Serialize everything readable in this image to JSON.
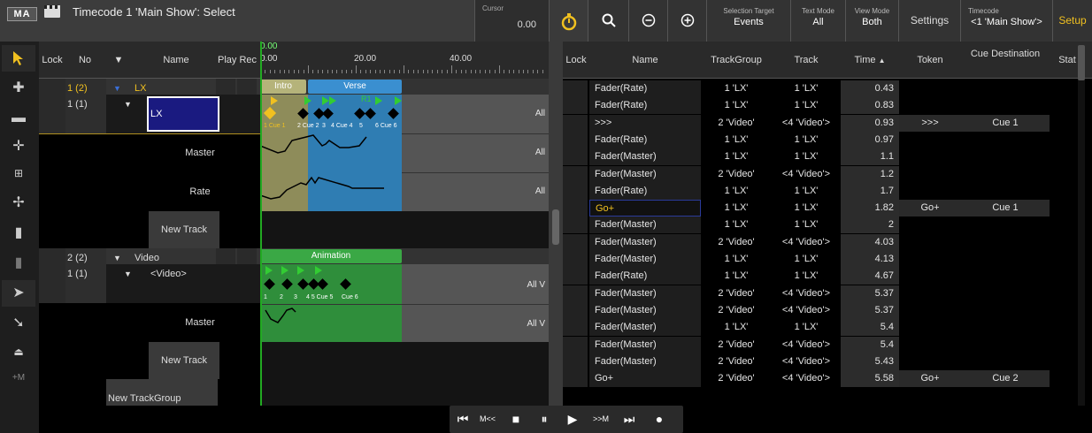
{
  "window": {
    "logo": "MA",
    "title": "Timecode 1 'Main Show': Select"
  },
  "cursor": {
    "label": "Cursor",
    "value": "0.00"
  },
  "toolbar": {
    "selection_target_label": "Selection Target",
    "selection_target_value": "Events",
    "text_mode_label": "Text Mode",
    "text_mode_value": "All",
    "view_mode_label": "View Mode",
    "view_mode_value": "Both",
    "settings": "Settings",
    "timecode_label": "Timecode",
    "timecode_value": "<1 'Main Show'>",
    "setup": "Setup"
  },
  "left_header": {
    "lock": "Lock",
    "no": "No",
    "name": "Name",
    "play_rec": "Play Rec",
    "cursor_time": "0.00",
    "ruler_0": "0.00",
    "ruler_20": "20.00",
    "ruler_40": "40.00"
  },
  "left_rows": [
    {
      "no": "1 (2)",
      "name": "LX",
      "kind": "group"
    },
    {
      "no": "1 (1)",
      "name": "LX",
      "kind": "track",
      "mode": "All"
    },
    {
      "no": "",
      "name": "Master",
      "kind": "sub",
      "mode": "All"
    },
    {
      "no": "",
      "name": "Rate",
      "kind": "sub",
      "mode": "All"
    },
    {
      "no": "",
      "name": "New Track",
      "kind": "new"
    },
    {
      "no": "2 (2)",
      "name": "Video",
      "kind": "group"
    },
    {
      "no": "1 (1)",
      "name": "<Video>",
      "kind": "track",
      "mode": "All V"
    },
    {
      "no": "",
      "name": "Master",
      "kind": "sub",
      "mode": "All V"
    },
    {
      "no": "",
      "name": "New Track",
      "kind": "new"
    },
    {
      "no": "",
      "name": "New TrackGroup",
      "kind": "newgroup"
    }
  ],
  "events": {
    "intro": "Intro",
    "verse": "Verse",
    "animation": "Animation"
  },
  "cue_labels_lx": {
    "a": "1 Cue 1",
    "b": "2 Cue 2",
    "c": "3",
    "d": "4 Cue 4",
    "e": "5",
    "f": "6 Cue 6"
  },
  "cue_labels_video": {
    "a": "1",
    "b": "2",
    "c": "3",
    "d": "4 5 Cue 5",
    "e": "Cue 6"
  },
  "marker_r1": "R1",
  "right_header": {
    "lock": "Lock",
    "name": "Name",
    "trackgroup": "TrackGroup",
    "track": "Track",
    "time": "Time",
    "token": "Token",
    "cue_dest": "Cue Destination",
    "status": "Stat"
  },
  "right_rows": [
    {
      "name": "Fader(Rate)",
      "tg": "1 'LX'",
      "track": "1 'LX'",
      "time": "0.43",
      "token": "",
      "cue": ""
    },
    {
      "name": "Fader(Rate)",
      "tg": "1 'LX'",
      "track": "1 'LX'",
      "time": "0.83",
      "token": "",
      "cue": ""
    },
    {
      "name": ">>>",
      "tg": "2 'Video'",
      "track": "<4 'Video'>",
      "time": "0.93",
      "token": ">>>",
      "cue": "Cue 1"
    },
    {
      "name": "Fader(Rate)",
      "tg": "1 'LX'",
      "track": "1 'LX'",
      "time": "0.97",
      "token": "",
      "cue": ""
    },
    {
      "name": "Fader(Master)",
      "tg": "1 'LX'",
      "track": "1 'LX'",
      "time": "1.1",
      "token": "",
      "cue": ""
    },
    {
      "name": "Fader(Master)",
      "tg": "2 'Video'",
      "track": "<4 'Video'>",
      "time": "1.2",
      "token": "",
      "cue": ""
    },
    {
      "name": "Fader(Rate)",
      "tg": "1 'LX'",
      "track": "1 'LX'",
      "time": "1.7",
      "token": "",
      "cue": ""
    },
    {
      "name": "Go+",
      "tg": "1 'LX'",
      "track": "1 'LX'",
      "time": "1.82",
      "token": "Go+",
      "cue": "Cue 1"
    },
    {
      "name": "Fader(Master)",
      "tg": "1 'LX'",
      "track": "1 'LX'",
      "time": "2",
      "token": "",
      "cue": ""
    },
    {
      "name": "Fader(Master)",
      "tg": "2 'Video'",
      "track": "<4 'Video'>",
      "time": "4.03",
      "token": "",
      "cue": ""
    },
    {
      "name": "Fader(Master)",
      "tg": "1 'LX'",
      "track": "1 'LX'",
      "time": "4.13",
      "token": "",
      "cue": ""
    },
    {
      "name": "Fader(Rate)",
      "tg": "1 'LX'",
      "track": "1 'LX'",
      "time": "4.67",
      "token": "",
      "cue": ""
    },
    {
      "name": "Fader(Master)",
      "tg": "2 'Video'",
      "track": "<4 'Video'>",
      "time": "5.37",
      "token": "",
      "cue": ""
    },
    {
      "name": "Fader(Master)",
      "tg": "2 'Video'",
      "track": "<4 'Video'>",
      "time": "5.37",
      "token": "",
      "cue": ""
    },
    {
      "name": "Fader(Master)",
      "tg": "1 'LX'",
      "track": "1 'LX'",
      "time": "5.4",
      "token": "",
      "cue": ""
    },
    {
      "name": "Fader(Master)",
      "tg": "2 'Video'",
      "track": "<4 'Video'>",
      "time": "5.4",
      "token": "",
      "cue": ""
    },
    {
      "name": "Fader(Master)",
      "tg": "2 'Video'",
      "track": "<4 'Video'>",
      "time": "5.43",
      "token": "",
      "cue": ""
    },
    {
      "name": "Go+",
      "tg": "2 'Video'",
      "track": "<4 'Video'>",
      "time": "5.58",
      "token": "Go+",
      "cue": "Cue 2"
    }
  ],
  "sidebar": {
    "plus_m": "+M"
  },
  "transport": {
    "prev": "⏮",
    "mrew": "M<<",
    "stop": "■",
    "pause": "⏸",
    "play": "▶",
    "mff": ">>M",
    "next": "⏭",
    "rec": "●"
  },
  "colors": {
    "accent": "#f0c020",
    "intro": "#b5b37a",
    "verse": "#3a8fd0",
    "animation": "#3aa845",
    "select": "#1a1a80"
  }
}
